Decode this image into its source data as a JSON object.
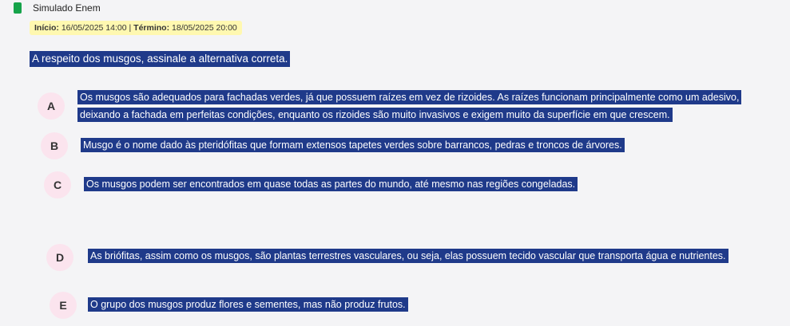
{
  "app": {
    "title": "Simulado Enem"
  },
  "dates": {
    "start_label": "Início:",
    "start_value": "16/05/2025 14:00",
    "separator": "|",
    "end_label": "Término:",
    "end_value": "18/05/2025 20:00"
  },
  "question": "A respeito dos musgos, assinale a alternativa correta.",
  "options": [
    {
      "letter": "A",
      "text": "Os musgos são adequados para fachadas verdes, já que possuem raízes em vez de rizoides. As raízes funcionam principalmente como um adesivo, deixando a fachada em perfeitas condições, enquanto os rizoides são muito invasivos e exigem muito da superfície em que crescem."
    },
    {
      "letter": "B",
      "text": "Musgo é o nome dado às pteridófitas que formam extensos tapetes verdes sobre barrancos, pedras e troncos de árvores."
    },
    {
      "letter": "C",
      "text": "Os musgos podem ser encontrados em quase todas as partes do mundo, até mesmo nas regiões congeladas."
    },
    {
      "letter": "D",
      "text": "As briófitas, assim como os musgos, são plantas terrestres vasculares, ou seja, elas possuem tecido vascular que transporta água e nutrientes."
    },
    {
      "letter": "E",
      "text": "O grupo dos musgos produz flores e sementes, mas não produz frutos."
    }
  ],
  "colors": {
    "highlight": "#1f3a8a",
    "letter_bg": "#fbe4ee",
    "date_bg": "#fff8b0",
    "icon": "#16a34a"
  }
}
